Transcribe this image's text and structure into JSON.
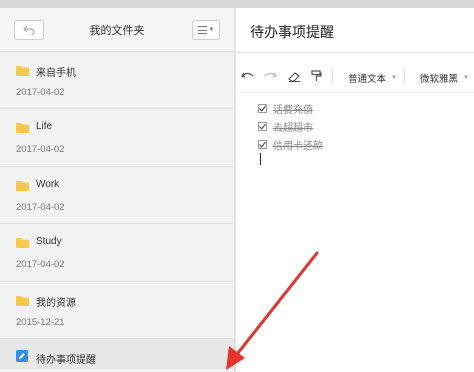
{
  "sidebar": {
    "title": "我的文件夹",
    "back_icon": "undo-icon",
    "view_icon": "list-view-icon",
    "folders": [
      {
        "name": "来自手机",
        "date": "2017-04-02"
      },
      {
        "name": "Life",
        "date": "2017-04-02"
      },
      {
        "name": "Work",
        "date": "2017-04-02"
      },
      {
        "name": "Study",
        "date": "2017-04-02"
      },
      {
        "name": "我的资源",
        "date": "2015-12-21"
      }
    ],
    "active_note": {
      "name": "待办事项提醒"
    }
  },
  "note": {
    "title": "待办事项提醒",
    "toolbar": {
      "undo_icon": "undo-icon",
      "redo_icon": "redo-icon",
      "eraser_icon": "eraser-icon",
      "format_painter_icon": "format-painter-icon",
      "paragraph_style": "普通文本",
      "font_family": "微软雅黑"
    },
    "todos": [
      {
        "text": "话费充值",
        "checked": true
      },
      {
        "text": "去超超市",
        "checked": true
      },
      {
        "text": "信用卡还款",
        "checked": true
      }
    ]
  },
  "colors": {
    "accent": "#2f8ee6",
    "folder": "#f7c948",
    "arrow": "#e8322b"
  }
}
